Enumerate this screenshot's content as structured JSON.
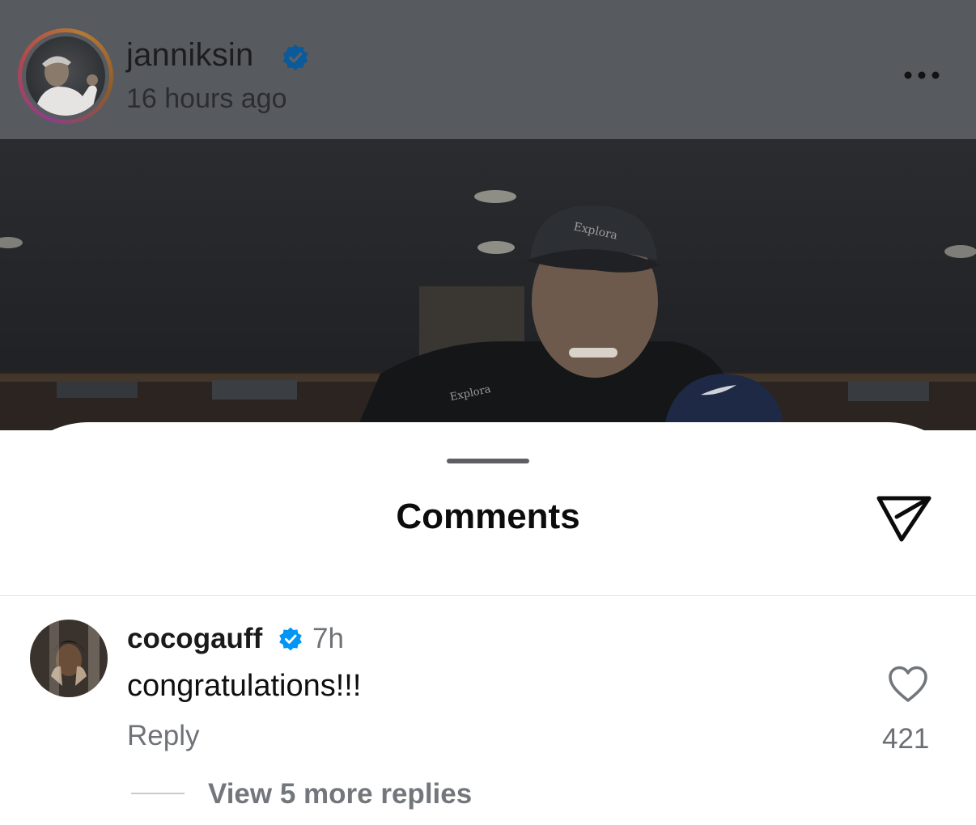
{
  "post": {
    "username": "janniksin",
    "time_ago": "16 hours ago",
    "more_icon": "ellipsis-icon",
    "verified_icon": "verified-badge-icon"
  },
  "photo": {
    "cap_text": "Explora",
    "jacket_text": "Explora"
  },
  "comments_sheet": {
    "title": "Comments",
    "share_icon": "send-icon"
  },
  "comment": {
    "username": "cocogauff",
    "time": "7h",
    "text": "congratulations!!!",
    "reply_label": "Reply",
    "like_count": "421",
    "view_replies_label": "View 5 more replies"
  },
  "colors": {
    "verified_blue": "#0095f6",
    "dim_overlay": "#575b60"
  }
}
